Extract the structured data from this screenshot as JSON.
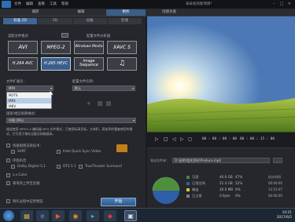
{
  "window": {
    "menu": [
      "文件",
      "编辑",
      "查看",
      "工具",
      "帮助"
    ],
    "title": "未命名的新项目*",
    "controls": [
      "–",
      "□",
      "✕"
    ]
  },
  "main_tabs": [
    {
      "label": "捕获",
      "active": false
    },
    {
      "label": "编辑",
      "active": false
    },
    {
      "label": "制作",
      "active": true
    },
    {
      "label": "创建光盘",
      "active": false
    }
  ],
  "sub_tabs": [
    "标准 2D",
    "3D",
    "设备",
    "在线"
  ],
  "left": {
    "format_label": "选取文件格式",
    "profile_label": "配置文件分析器",
    "formats_row1": [
      "AVI",
      "MPEG-2",
      "Windows Media",
      "XAVC S"
    ],
    "formats_row2": [
      "H.264 AVC",
      "H.265 HEVC",
      "Image Sequence",
      "♫"
    ],
    "file_ext_label": "文件扩展名：",
    "file_ext_value": "MP4",
    "ext_options": [
      "M2TS",
      "MP4",
      "MKV"
    ],
    "profile_name_label": "配置文件名称：",
    "profile_name_value": "默认",
    "country_label": "国家/地区视频格式：",
    "country_value": "中国 (PAL)",
    "description": "描述使用 MPEG-4 编码器 MP4 文件格式，已使用标清目标。大体积，高效率的重复使用的格式，它可用于储存设备及网络媒体。",
    "fast_render_label": "快速视频渲染技术：",
    "fast_render_options": [
      "SVRT",
      "Intel Quick Sync Video"
    ],
    "surround_label": "环绕声音",
    "audio_options": [
      "Dolby Digital 5.1",
      "DTS 5.1",
      "TrueTheater Surround"
    ],
    "x_v_color": "x.v.Color",
    "upload_label": "将项目上传至云端",
    "auto_shutdown": "制作过程中应用预览",
    "start_button": "开始"
  },
  "transport": {
    "time_current": "00 : 00 : 00 : 00",
    "time_total": "00 : 00 : 15 : 00"
  },
  "output": {
    "folder_label": "导出文件夹：",
    "path": "D:\\说明\\相关资料\\Produce.mp4",
    "browse_label": "...",
    "disk_stats": [
      {
        "name": "可用",
        "value": "46.6 GB",
        "pct": "47%",
        "color": "#3c8a3c"
      },
      {
        "name": "已用空间",
        "value": "51.4 GB",
        "pct": "52%",
        "color": "#2f5fa8"
      },
      {
        "name": "输出",
        "value": "26.0 MB",
        "pct": "0%",
        "color": "#d8c53a"
      },
      {
        "name": "已占用",
        "value": "0 Byte",
        "pct": "0%",
        "color": "#7a7f88"
      }
    ],
    "side_label": "估计时间",
    "side_values": [
      "00:00:00",
      "12:15:47",
      "00:00:00"
    ]
  },
  "taskbar": {
    "time": "10:21",
    "date": "2017/6/5"
  }
}
